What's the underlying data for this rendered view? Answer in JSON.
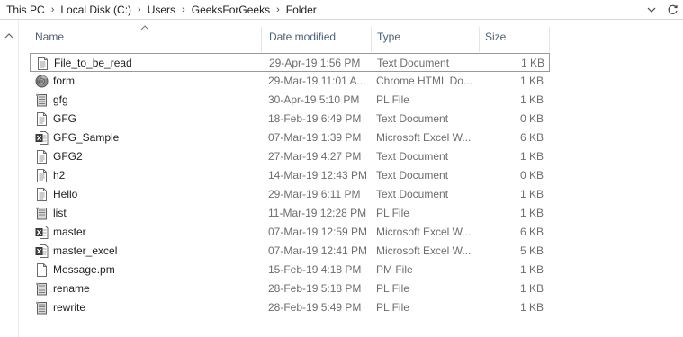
{
  "breadcrumb": [
    "This PC",
    "Local Disk (C:)",
    "Users",
    "GeeksForGeeks",
    "Folder"
  ],
  "columns": {
    "name": "Name",
    "date": "Date modified",
    "type": "Type",
    "size": "Size"
  },
  "files": [
    {
      "name": "File_to_be_read",
      "date": "29-Apr-19 1:56 PM",
      "type": "Text Document",
      "size": "1 KB",
      "icon": "text-file-icon"
    },
    {
      "name": "form",
      "date": "29-Mar-19 11:01 A...",
      "type": "Chrome HTML Do...",
      "size": "1 KB",
      "icon": "chrome-html-icon"
    },
    {
      "name": "gfg",
      "date": "30-Apr-19 5:10 PM",
      "type": "PL File",
      "size": "1 KB",
      "icon": "pl-file-icon"
    },
    {
      "name": "GFG",
      "date": "18-Feb-19 6:49 PM",
      "type": "Text Document",
      "size": "0 KB",
      "icon": "text-file-icon"
    },
    {
      "name": "GFG_Sample",
      "date": "07-Mar-19 1:39 PM",
      "type": "Microsoft Excel W...",
      "size": "6 KB",
      "icon": "excel-file-icon"
    },
    {
      "name": "GFG2",
      "date": "27-Mar-19 4:27 PM",
      "type": "Text Document",
      "size": "1 KB",
      "icon": "text-file-icon"
    },
    {
      "name": "h2",
      "date": "14-Mar-19 12:43 PM",
      "type": "Text Document",
      "size": "0 KB",
      "icon": "text-file-icon"
    },
    {
      "name": "Hello",
      "date": "29-Mar-19 6:11 PM",
      "type": "Text Document",
      "size": "1 KB",
      "icon": "text-file-icon"
    },
    {
      "name": "list",
      "date": "11-Mar-19 12:28 PM",
      "type": "PL File",
      "size": "1 KB",
      "icon": "pl-file-icon"
    },
    {
      "name": "master",
      "date": "07-Mar-19 12:59 PM",
      "type": "Microsoft Excel W...",
      "size": "6 KB",
      "icon": "excel-file-icon"
    },
    {
      "name": "master_excel",
      "date": "07-Mar-19 12:41 PM",
      "type": "Microsoft Excel W...",
      "size": "5 KB",
      "icon": "excel-file-icon"
    },
    {
      "name": "Message.pm",
      "date": "15-Feb-19 4:18 PM",
      "type": "PM File",
      "size": "1 KB",
      "icon": "blank-file-icon"
    },
    {
      "name": "rename",
      "date": "28-Feb-19 5:18 PM",
      "type": "PL File",
      "size": "1 KB",
      "icon": "pl-file-icon"
    },
    {
      "name": "rewrite",
      "date": "28-Feb-19 5:49 PM",
      "type": "PL File",
      "size": "1 KB",
      "icon": "pl-file-icon"
    }
  ],
  "icons": {
    "dropdown": "chevron-down-icon",
    "refresh": "refresh-icon",
    "nav_collapse": "chevron-up-icon",
    "sort": "sort-ascending-icon"
  }
}
